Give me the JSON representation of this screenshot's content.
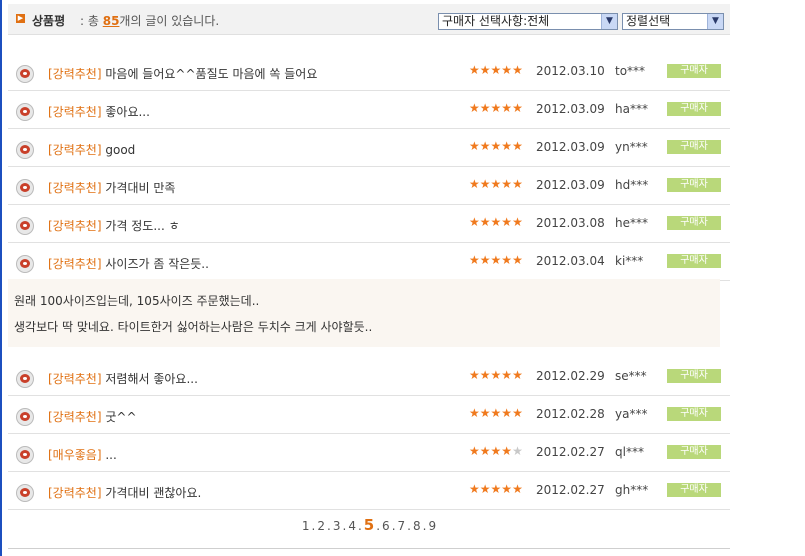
{
  "header": {
    "title": "상품평",
    "text_prefix": " : 총 ",
    "count": "85",
    "text_suffix": "개의 글이 있습니다.",
    "buyer_filter": "구매자 선택사항:전체",
    "sort_select": "정렬선택"
  },
  "reviews": [
    {
      "tag": "[강력추천]",
      "subject": "마음에 들어요^^품질도 마음에 쏙 들어요",
      "stars": 5,
      "date": "2012.03.10",
      "user": "to***",
      "badge": "구매자"
    },
    {
      "tag": "[강력추천]",
      "subject": "좋아요...",
      "stars": 5,
      "date": "2012.03.09",
      "user": "ha***",
      "badge": "구매자"
    },
    {
      "tag": "[강력추천]",
      "subject": "good",
      "stars": 5,
      "date": "2012.03.09",
      "user": "yn***",
      "badge": "구매자"
    },
    {
      "tag": "[강력추천]",
      "subject": "가격대비 만족",
      "stars": 5,
      "date": "2012.03.09",
      "user": "hd***",
      "badge": "구매자"
    },
    {
      "tag": "[강력추천]",
      "subject": "가격 정도... ㅎ",
      "stars": 5,
      "date": "2012.03.08",
      "user": "he***",
      "badge": "구매자"
    },
    {
      "tag": "[강력추천]",
      "subject": "사이즈가 좀 작은듯..",
      "stars": 5,
      "date": "2012.03.04",
      "user": "ki***",
      "badge": "구매자"
    },
    {
      "tag": "[강력추천]",
      "subject": "저렴해서 좋아요...",
      "stars": 5,
      "date": "2012.02.29",
      "user": "se***",
      "badge": "구매자"
    },
    {
      "tag": "[강력추천]",
      "subject": "굿^^",
      "stars": 5,
      "date": "2012.02.28",
      "user": "ya***",
      "badge": "구매자"
    },
    {
      "tag": "[매우좋음]",
      "subject": "...",
      "stars": 4,
      "date": "2012.02.27",
      "user": "ql***",
      "badge": "구매자"
    },
    {
      "tag": "[강력추천]",
      "subject": "가격대비 괜찮아요.",
      "stars": 5,
      "date": "2012.02.27",
      "user": "gh***",
      "badge": "구매자"
    }
  ],
  "expanded_review": {
    "line1": "원래 100사이즈입는데, 105사이즈 주문했는데..",
    "line2": "생각보다 딱 맞네요. 타이트한거 싫어하는사람은 두치수 크게 사야할듯.."
  },
  "pagination": {
    "pages": [
      "1",
      "2",
      "3",
      "4",
      "5",
      "6",
      "7",
      "8",
      "9"
    ],
    "current": "5",
    "separator": "."
  },
  "colors": {
    "accent": "#e07012",
    "star": "#f07a1e",
    "badge": "#b9d87a"
  },
  "icons": {
    "star_filled": "★",
    "star_empty": "★",
    "select_arrow": "▼",
    "header_bullet": "▶"
  }
}
